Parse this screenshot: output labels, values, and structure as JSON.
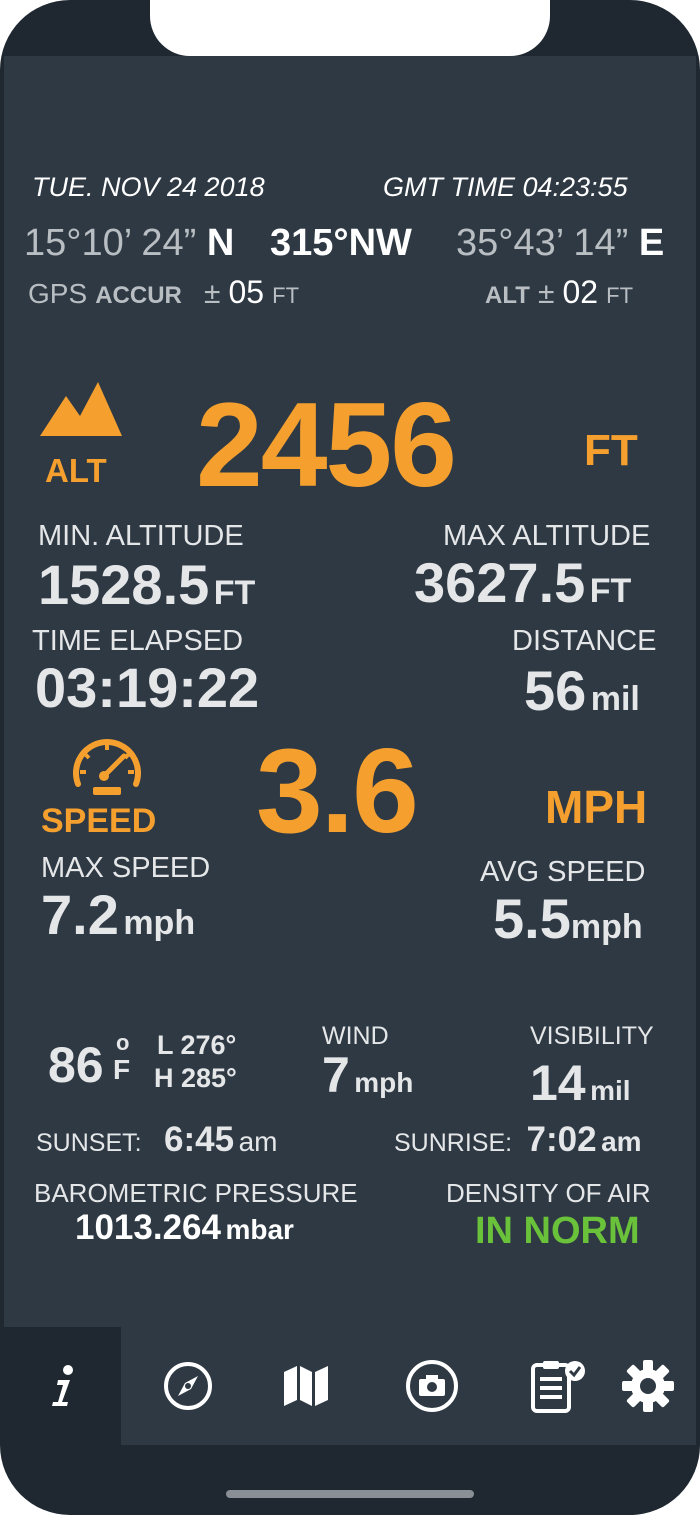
{
  "header": {
    "date": "TUE.  NOV 24 2018",
    "gmt_time": "GMT TIME 04:23:55",
    "lat_value": "15°10’ 24”",
    "lat_dir": "N",
    "heading": "315°NW",
    "lon_value": "35°43’ 14”",
    "lon_dir": "E",
    "gps_label": "GPS",
    "accur_label": "ACCUR",
    "pm": "±",
    "gps_value": "05",
    "gps_unit": "FT",
    "alt_label": "ALT",
    "alt_acc_value": "02",
    "alt_acc_unit": "FT"
  },
  "altitude": {
    "label": "ALT",
    "value": "2456",
    "unit": "FT",
    "icon": "mountain-icon",
    "min_label": "MIN. ALTITUDE",
    "min_value": "1528.5",
    "min_unit": "FT",
    "max_label": "MAX ALTITUDE",
    "max_value": "3627.5",
    "max_unit": "FT"
  },
  "trip": {
    "time_label": "TIME ELAPSED",
    "time_value": "03:19:22",
    "distance_label": "DISTANCE",
    "distance_value": "56",
    "distance_unit": "mil"
  },
  "speed": {
    "label": "SPEED",
    "value": "3.6",
    "unit": "MPH",
    "icon": "speedometer-icon",
    "max_label": "MAX SPEED",
    "max_value": "7.2",
    "max_unit": "mph",
    "avg_label": "AVG SPEED",
    "avg_value": "5.5",
    "avg_unit": "mph"
  },
  "weather": {
    "temp": "86",
    "temp_deg": "o",
    "temp_unit": "F",
    "low": "L 276°",
    "high": "H 285°",
    "wind_label": "WIND",
    "wind_value": "7",
    "wind_unit": "mph",
    "visibility_label": "VISIBILITY",
    "visibility_value": "14",
    "visibility_unit": "mil",
    "sunset_label": "SUNSET:",
    "sunset_value": "6:45",
    "sunset_unit": "am",
    "sunrise_label": "SUNRISE:",
    "sunrise_value": "7:02",
    "sunrise_unit": "am",
    "pressure_label": "BAROMETRIC PRESSURE",
    "pressure_value": "1013.264",
    "pressure_unit": "mbar",
    "density_label": "DENSITY OF AIR",
    "density_value": "IN NORM"
  },
  "tabs": [
    {
      "icon": "info-icon",
      "active": true
    },
    {
      "icon": "compass-icon",
      "active": false
    },
    {
      "icon": "map-icon",
      "active": false
    },
    {
      "icon": "camera-icon",
      "active": false
    },
    {
      "icon": "clipboard-check-icon",
      "active": false
    },
    {
      "icon": "gear-icon",
      "active": false
    }
  ],
  "colors": {
    "accent": "#f5a02e",
    "ok": "#6ac13a",
    "background": "#2e3944",
    "frame": "#1f2831"
  }
}
